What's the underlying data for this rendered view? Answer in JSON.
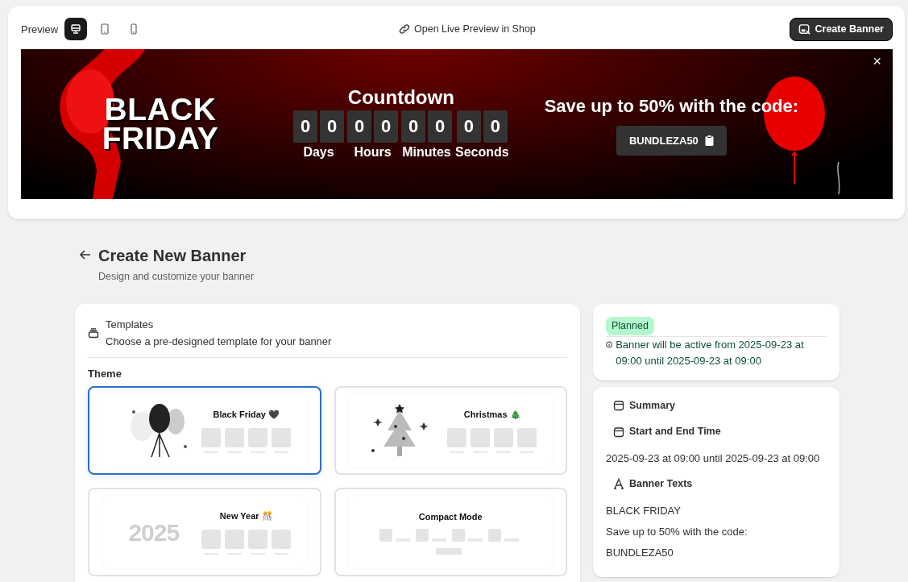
{
  "preview": {
    "label": "Preview",
    "devices": [
      {
        "kind": "desktop",
        "selected": true
      },
      {
        "kind": "tablet",
        "selected": false
      },
      {
        "kind": "mobile",
        "selected": false
      }
    ],
    "live_link": "Open Live Preview in Shop",
    "create_button": "Create Banner"
  },
  "banner": {
    "title_lines": [
      "BLACK",
      "FRIDAY"
    ],
    "countdown_title": "Countdown",
    "units": [
      {
        "label": "Days",
        "digits": [
          "0",
          "0"
        ]
      },
      {
        "label": "Hours",
        "digits": [
          "0",
          "0"
        ]
      },
      {
        "label": "Minutes",
        "digits": [
          "0",
          "0"
        ]
      },
      {
        "label": "Seconds",
        "digits": [
          "0",
          "0"
        ]
      }
    ],
    "promo_text": "Save up to 50% with the code:",
    "code": "BUNDLEZA50",
    "close": "×"
  },
  "header": {
    "title": "Create New Banner",
    "subtitle": "Design and customize your banner"
  },
  "templates": {
    "title": "Templates",
    "description": "Choose a pre-designed template for your banner",
    "theme_label": "Theme",
    "items": [
      {
        "kind": "balloons",
        "name": "Black Friday 🖤",
        "selected": true
      },
      {
        "kind": "tree",
        "name": "Christmas 🎄",
        "selected": false
      },
      {
        "kind": "year",
        "name": "New Year 🎊",
        "art_text": "2025",
        "selected": false
      },
      {
        "kind": "compact",
        "name": "Compact Mode",
        "selected": false
      }
    ]
  },
  "status": {
    "badge": "Planned",
    "message": "Banner will be active from 2025-09-23 at 09:00 until 2025-09-23 at 09:00"
  },
  "summary": {
    "title": "Summary",
    "sections": [
      {
        "kind": "time",
        "title": "Start and End Time",
        "lines": [
          "2025-09-23 at 09:00 until 2025-09-23 at 09:00"
        ]
      },
      {
        "kind": "text",
        "title": "Banner Texts",
        "lines": [
          "BLACK FRIDAY",
          "Save up to 50% with the code:",
          "BUNDLEZA50"
        ]
      }
    ]
  }
}
